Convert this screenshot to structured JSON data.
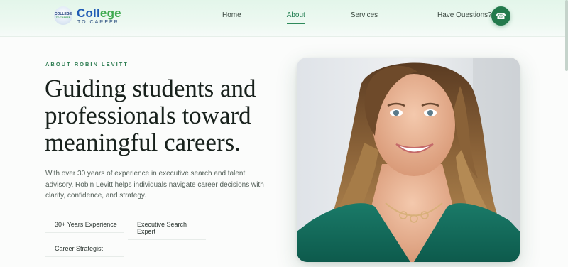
{
  "header": {
    "logo": {
      "badge_line1": "COLLEGE",
      "badge_line2": "TO CAREER",
      "main": "College",
      "sub": "TO CAREER"
    },
    "nav": [
      {
        "label": "Home",
        "active": false
      },
      {
        "label": "About",
        "active": true
      },
      {
        "label": "Services",
        "active": false
      }
    ],
    "contact_label": "Have Questions?",
    "phone_icon": "phone-icon"
  },
  "hero": {
    "eyebrow": "ABOUT ROBIN LEVITT",
    "headline": "Guiding students and professionals toward meaningful careers.",
    "intro": "With over 30 years of experience in executive search and talent advisory, Robin Levitt helps individuals navigate career decisions with clarity, confidence, and strategy.",
    "tags": [
      "30+ Years Experience",
      "Executive Search Expert",
      "Career Strategist"
    ]
  },
  "colors": {
    "accent": "#237a4c",
    "logo_blue": "#1f5bb5",
    "logo_green": "#3eaa4f"
  }
}
